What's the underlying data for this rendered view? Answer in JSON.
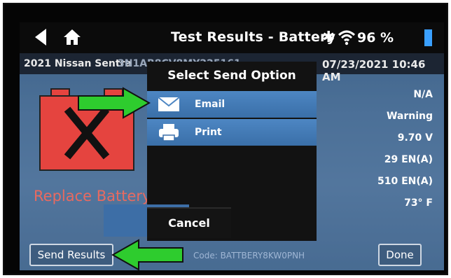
{
  "header": {
    "title": "Test Results - Battery",
    "battery_percent": "96 %"
  },
  "info": {
    "vehicle": "2021 Nissan Sentra",
    "vin": "3N1AB8CV8MY225161",
    "datetime": "07/23/2021 10:46 AM"
  },
  "result": {
    "status": "Replace Battery"
  },
  "readings": [
    "N/A",
    "Warning",
    "9.70 V",
    "29 EN(A)",
    "510 EN(A)",
    "73° F"
  ],
  "dialog": {
    "title": "Select Send Option",
    "options": [
      {
        "label": "Email",
        "icon": "envelope-icon"
      },
      {
        "label": "Print",
        "icon": "printer-icon"
      }
    ],
    "cancel_label": "Cancel"
  },
  "footer": {
    "send_label": "Send Results",
    "code_text": "Code: BATTBERY8KW0PNH",
    "done_label": "Done"
  },
  "colors": {
    "arrow": "#2ecc2e",
    "accent": "#3aa0ff",
    "battery": "#e5443f"
  }
}
